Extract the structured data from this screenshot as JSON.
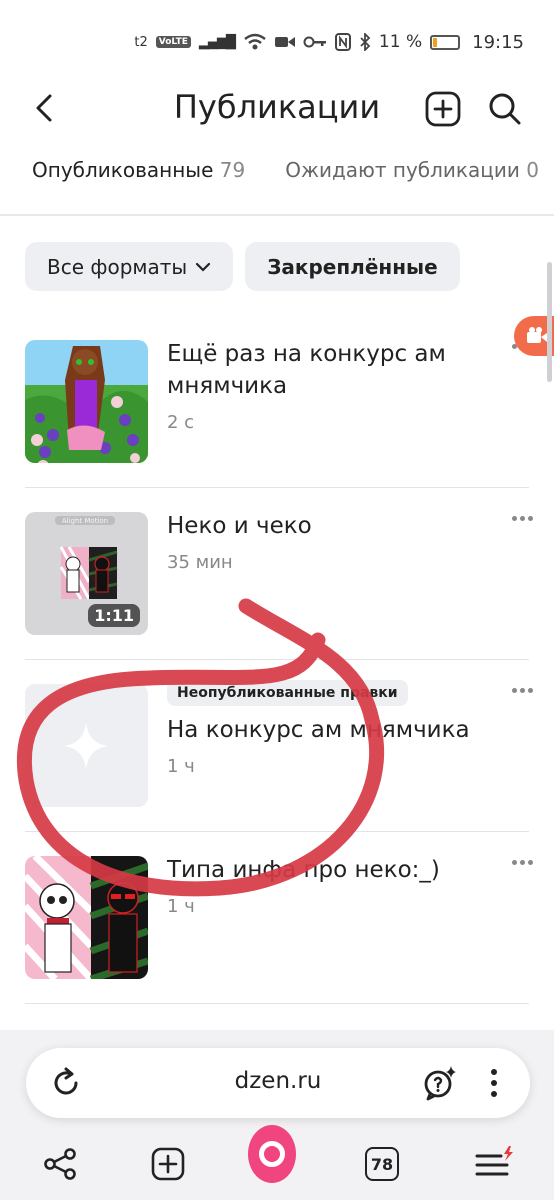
{
  "status_bar": {
    "carrier": "t2",
    "volte": "VoLTE",
    "battery": "11 %",
    "battery_level": 0.11,
    "time": "19:15"
  },
  "header": {
    "title": "Публикации",
    "icons": [
      "back-arrow-icon",
      "add-square-icon",
      "search-icon"
    ]
  },
  "tabs": [
    {
      "label": "Опубликованные",
      "count": "79",
      "active": true
    },
    {
      "label": "Ожидают публикации",
      "count": "0",
      "active": false
    }
  ],
  "filters": {
    "format_label": "Все форматы",
    "pinned_label": "Закреплённые"
  },
  "publications": [
    {
      "title": "Ещё раз на конкурс ам мнямчика",
      "meta": "2 с",
      "badge": "",
      "duration": ""
    },
    {
      "title": "Неко и чеко",
      "meta": "35 мин",
      "badge": "",
      "duration": "1:11",
      "watermark": "Alight Motion"
    },
    {
      "title": "На конкурс ам мнямчика",
      "meta": "1 ч",
      "badge": "Неопубликованные правки",
      "duration": ""
    },
    {
      "title": "Типа инфа про неко:_)",
      "meta": "1 ч",
      "badge": "",
      "duration": ""
    }
  ],
  "browser": {
    "url": "dzen.ru",
    "tabs_count": "78"
  },
  "colors": {
    "accent_red": "#d63a44",
    "alice_pink": "#f0457e",
    "chip_bg": "#eeeff2",
    "record_button": "#f26b4b"
  }
}
